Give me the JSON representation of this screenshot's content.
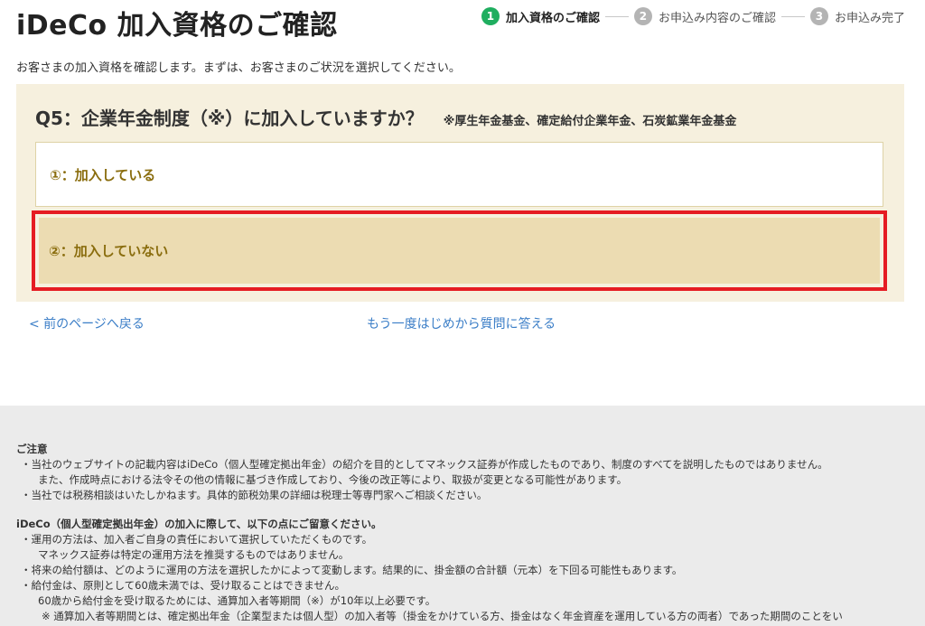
{
  "header": {
    "title": "iDeCo 加入資格のご確認",
    "steps": [
      {
        "num": "1",
        "label": "加入資格のご確認"
      },
      {
        "num": "2",
        "label": "お申込み内容のご確認"
      },
      {
        "num": "3",
        "label": "お申込み完了"
      }
    ]
  },
  "intro": "お客さまの加入資格を確認します。まずは、お客さまのご状況を選択してください。",
  "question": {
    "title": "Q5：企業年金制度（※）に加入していますか？",
    "note": "※厚生年金基金、確定給付企業年金、石炭鉱業年金基金",
    "options": [
      {
        "label": "①：加入している"
      },
      {
        "label": "②：加入していない"
      }
    ]
  },
  "nav": {
    "back": "< 前のページへ戻る",
    "restart": "もう一度はじめから質問に答える"
  },
  "footer": {
    "caution_heading": "ご注意",
    "caution_items": [
      "・当社のウェブサイトの記載内容はiDeCo（個人型確定拠出年金）の紹介を目的としてマネックス証券が作成したものであり、制度のすべてを説明したものではありません。",
      "また、作成時点における法令その他の情報に基づき作成しており、今後の改正等により、取扱が変更となる可能性があります。",
      "・当社では税務相談はいたしかねます。具体的節税効果の詳細は税理士等専門家へご相談ください。"
    ],
    "ideco_heading": "iDeCo（個人型確定拠出年金）の加入に際して、以下の点にご留意ください。",
    "ideco_items": [
      "・運用の方法は、加入者ご自身の責任において選択していただくものです。",
      "マネックス証券は特定の運用方法を推奨するものではありません。",
      "・将来の給付額は、どのように運用の方法を選択したかによって変動します。結果的に、掛金額の合計額（元本）を下回る可能性もあります。",
      "・給付金は、原則として60歳未満では、受け取ることはできません。",
      "60歳から給付金を受け取るためには、通算加入者等期間（※）が10年以上必要です。",
      "※ 通算加入者等期間とは、確定拠出年金（企業型または個人型）の加入者等（掛金をかけている方、掛金はなく年金資産を運用している方の両者）であった期間のことをい"
    ]
  }
}
